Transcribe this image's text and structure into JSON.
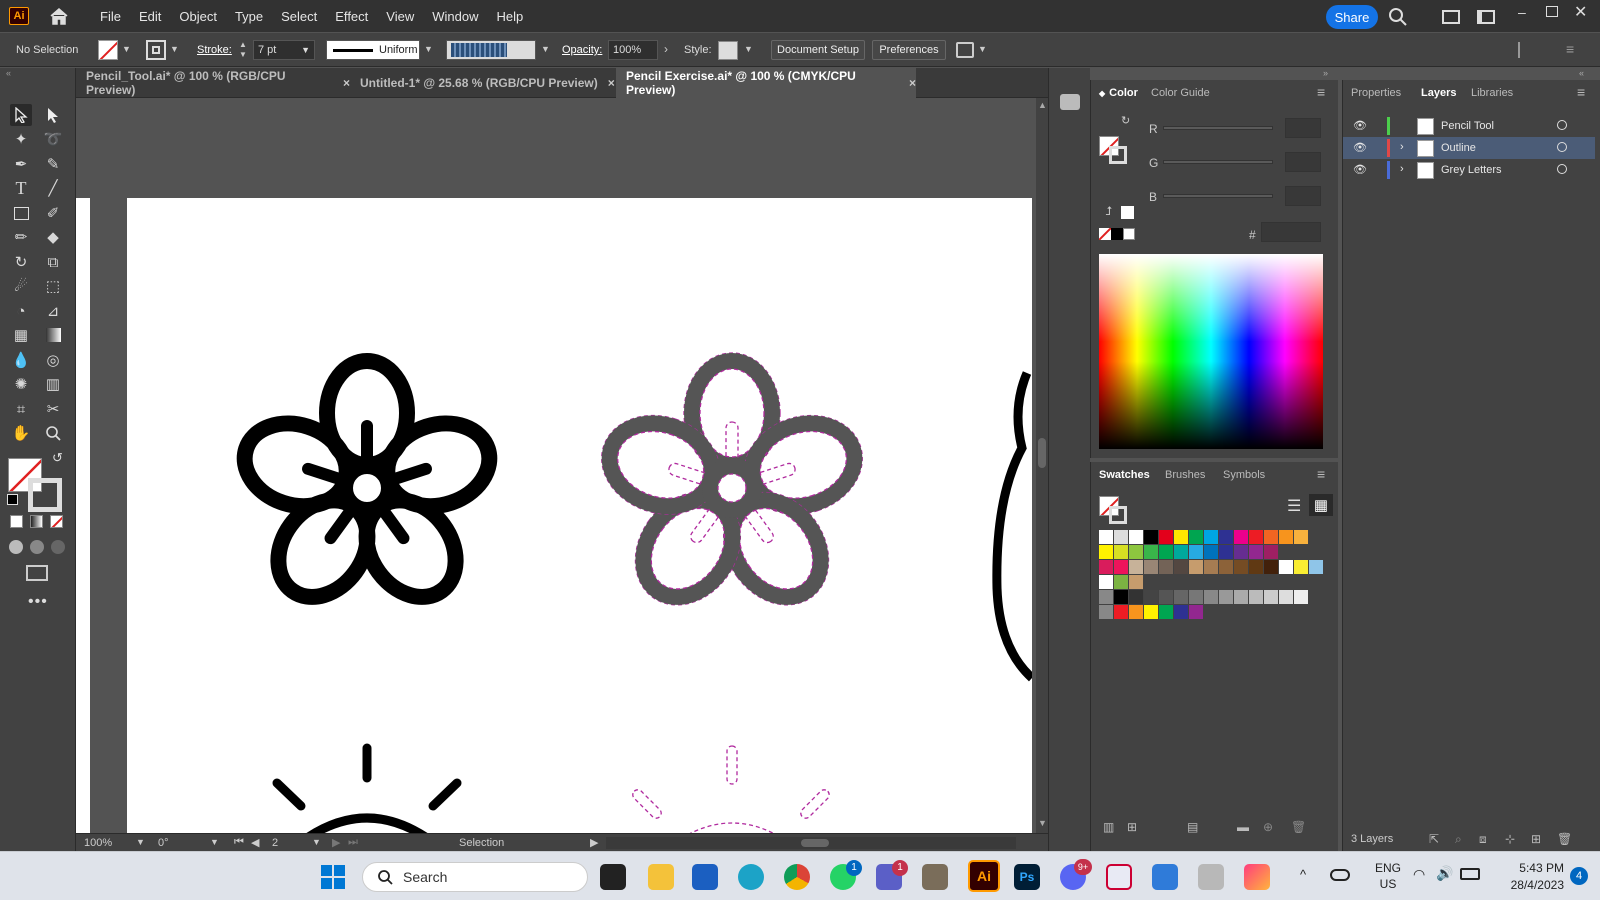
{
  "menu": {
    "app_badge": "Ai",
    "items": [
      "File",
      "Edit",
      "Object",
      "Type",
      "Select",
      "Effect",
      "View",
      "Window",
      "Help"
    ],
    "share": "Share"
  },
  "control": {
    "selection": "No Selection",
    "stroke_label": "Stroke:",
    "stroke_value": "7 pt",
    "profile": "Uniform",
    "opacity_label": "Opacity:",
    "opacity_value": "100%",
    "style_label": "Style:",
    "document_setup": "Document Setup",
    "preferences": "Preferences"
  },
  "tabs": [
    {
      "label": "Pencil_Tool.ai* @ 100 % (RGB/CPU Preview)",
      "close": "×"
    },
    {
      "label": "Untitled-1* @ 25.68 % (RGB/CPU Preview)",
      "close": "×"
    },
    {
      "label": "Pencil Exercise.ai* @ 100 % (CMYK/CPU Preview)",
      "close": "×"
    }
  ],
  "status": {
    "zoom": "100%",
    "rotation": "0°",
    "artboard": "2",
    "tool": "Selection"
  },
  "color_panel": {
    "tabs": [
      "Color",
      "Color Guide"
    ],
    "channels": [
      "R",
      "G",
      "B"
    ],
    "hex_label": "#"
  },
  "swatches_panel": {
    "tabs": [
      "Swatches",
      "Brushes",
      "Symbols"
    ]
  },
  "layers_panel": {
    "tabs": [
      "Properties",
      "Layers",
      "Libraries"
    ],
    "layers": [
      {
        "name": "Pencil Tool",
        "color": "#4ccf4c"
      },
      {
        "name": "Outline",
        "color": "#e04848"
      },
      {
        "name": "Grey Letters",
        "color": "#4a6cd8"
      }
    ],
    "count": "3 Layers"
  },
  "taskbar": {
    "search_placeholder": "Search",
    "lang": "ENG",
    "region": "US",
    "time": "5:43 PM",
    "date": "28/4/2023",
    "notif_count": "4",
    "whatsapp_badge": "1",
    "teams_badge": "1",
    "discord_badge": "9+"
  },
  "colors": {
    "accent": "#1473e6",
    "outline_guide": "#b02a9e",
    "selected_layer": "#4b5c77"
  }
}
